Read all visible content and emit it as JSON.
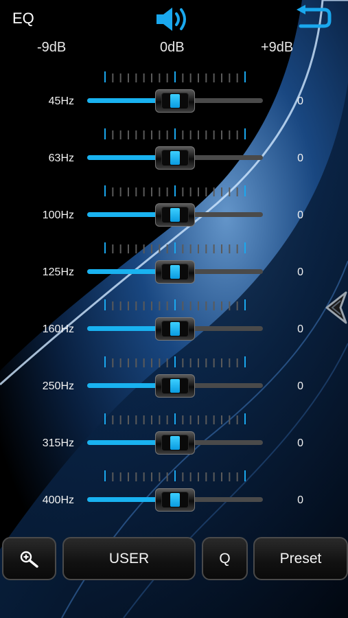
{
  "header": {
    "title": "EQ",
    "speaker_icon": "speaker-volume-icon",
    "back_icon": "return-arrow-icon"
  },
  "scale": {
    "min_label": "-9dB",
    "mid_label": "0dB",
    "max_label": "+9dB",
    "min_db": -9,
    "max_db": 9
  },
  "bands": [
    {
      "freq": "45Hz",
      "gain": "0",
      "value_db": 0
    },
    {
      "freq": "63Hz",
      "gain": "0",
      "value_db": 0
    },
    {
      "freq": "100Hz",
      "gain": "0",
      "value_db": 0
    },
    {
      "freq": "125Hz",
      "gain": "0",
      "value_db": 0
    },
    {
      "freq": "160Hz",
      "gain": "0",
      "value_db": 0
    },
    {
      "freq": "250Hz",
      "gain": "0",
      "value_db": 0
    },
    {
      "freq": "315Hz",
      "gain": "0",
      "value_db": 0
    },
    {
      "freq": "400Hz",
      "gain": "0",
      "value_db": 0
    }
  ],
  "buttons": {
    "zoom_icon": "zoom-in-icon",
    "user_label": "USER",
    "q_label": "Q",
    "preset_label": "Preset"
  },
  "side_arrow_icon": "collapse-arrow-icon",
  "colors": {
    "accent": "#19b2f0",
    "track": "#4a4a4a",
    "background": "#000000"
  }
}
